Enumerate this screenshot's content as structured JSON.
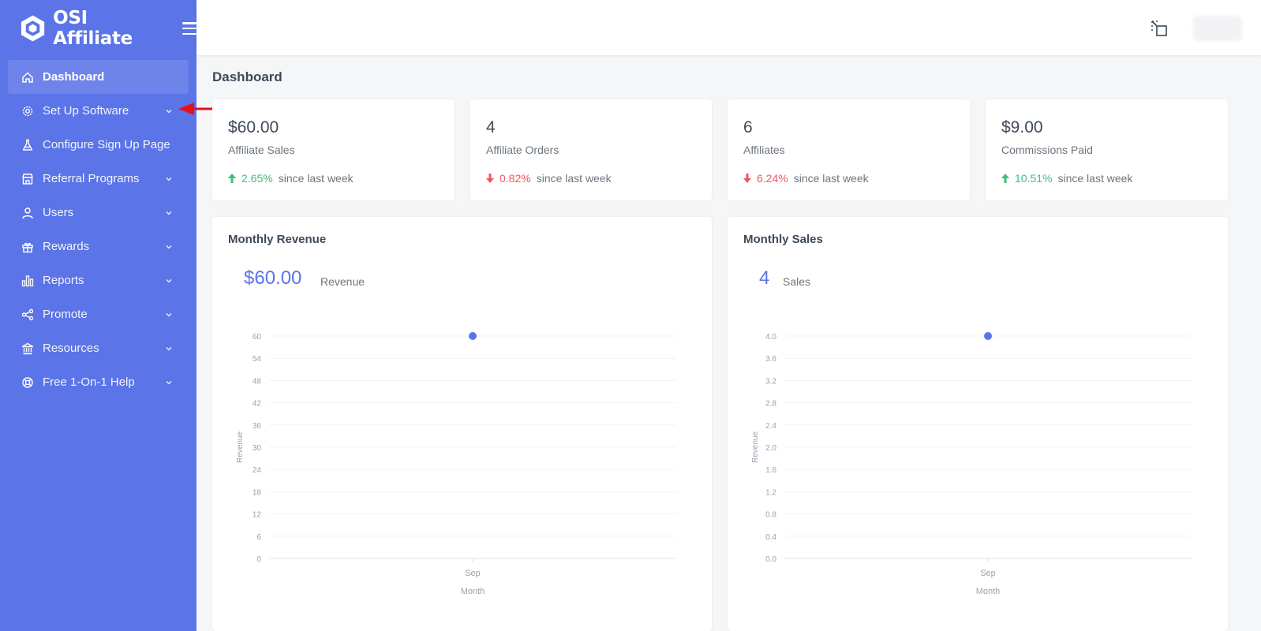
{
  "app": {
    "name": "OSI Affiliate"
  },
  "sidebar": {
    "items": [
      {
        "label": "Dashboard",
        "icon": "home-icon",
        "active": true,
        "chevron": false
      },
      {
        "label": "Set Up Software",
        "icon": "gear-icon",
        "active": false,
        "chevron": true
      },
      {
        "label": "Configure Sign Up Page",
        "icon": "flask-icon",
        "active": false,
        "chevron": false
      },
      {
        "label": "Referral Programs",
        "icon": "store-icon",
        "active": false,
        "chevron": true
      },
      {
        "label": "Users",
        "icon": "user-icon",
        "active": false,
        "chevron": true
      },
      {
        "label": "Rewards",
        "icon": "gift-icon",
        "active": false,
        "chevron": true
      },
      {
        "label": "Reports",
        "icon": "bar-chart-icon",
        "active": false,
        "chevron": true
      },
      {
        "label": "Promote",
        "icon": "share-icon",
        "active": false,
        "chevron": true
      },
      {
        "label": "Resources",
        "icon": "bank-icon",
        "active": false,
        "chevron": true
      },
      {
        "label": "Free 1-On-1 Help",
        "icon": "lifebuoy-icon",
        "active": false,
        "chevron": true
      }
    ]
  },
  "page": {
    "title": "Dashboard"
  },
  "stats": [
    {
      "value": "$60.00",
      "label": "Affiliate Sales",
      "trend": "2.65%",
      "direction": "up",
      "since": "since last week"
    },
    {
      "value": "4",
      "label": "Affiliate Orders",
      "trend": "0.82%",
      "direction": "down",
      "since": "since last week"
    },
    {
      "value": "6",
      "label": "Affiliates",
      "trend": "6.24%",
      "direction": "down",
      "since": "since last week"
    },
    {
      "value": "$9.00",
      "label": "Commissions Paid",
      "trend": "10.51%",
      "direction": "up",
      "since": "since last week"
    }
  ],
  "charts": {
    "revenue": {
      "title": "Monthly Revenue",
      "big_value": "$60.00",
      "big_label": "Revenue"
    },
    "sales": {
      "title": "Monthly Sales",
      "big_value": "4",
      "big_label": "Sales"
    }
  },
  "colors": {
    "sidebar": "#5b74e8",
    "accent": "#5b74e8",
    "up": "#3cc180",
    "down": "#f0575a",
    "annotation": "#e8101a"
  },
  "chart_data": [
    {
      "type": "scatter",
      "title": "Monthly Revenue",
      "categories": [
        "Sep"
      ],
      "values": [
        60
      ],
      "xlabel": "Month",
      "ylabel": "Revenue",
      "ylim": [
        0,
        60
      ],
      "yticks": [
        "60",
        "54",
        "48",
        "42",
        "36",
        "30",
        "24",
        "18",
        "12",
        "6",
        "0"
      ],
      "grid": true
    },
    {
      "type": "scatter",
      "title": "Monthly Sales",
      "categories": [
        "Sep"
      ],
      "values": [
        4
      ],
      "xlabel": "Month",
      "ylabel": "Revenue",
      "ylim": [
        0,
        4
      ],
      "yticks": [
        "4.0",
        "3.6",
        "3.2",
        "2.8",
        "2.4",
        "2.0",
        "1.6",
        "1.2",
        "0.8",
        "0.4",
        "0.0"
      ],
      "grid": true
    }
  ]
}
